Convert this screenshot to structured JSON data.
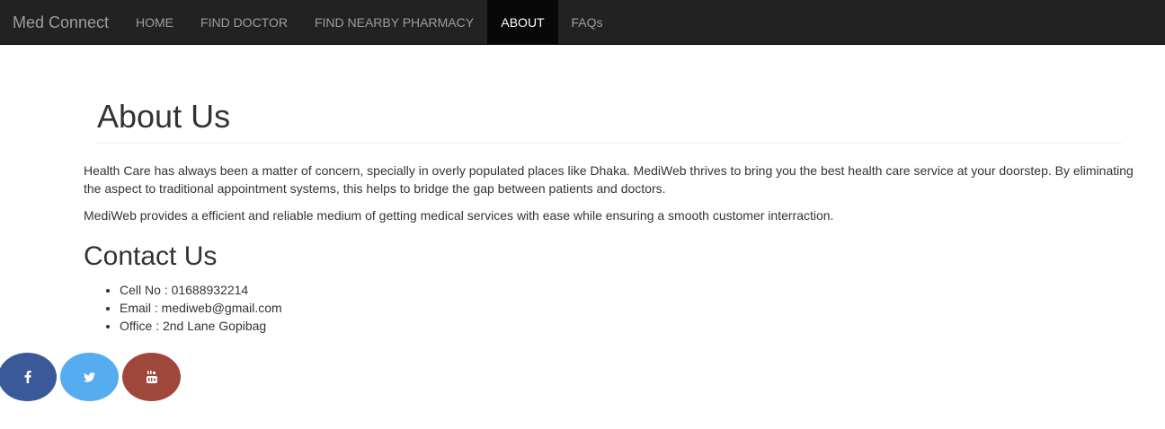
{
  "navbar": {
    "brand": "Med Connect",
    "items": [
      {
        "label": "HOME",
        "active": false
      },
      {
        "label": "FIND DOCTOR",
        "active": false
      },
      {
        "label": "FIND NEARBY PHARMACY",
        "active": false
      },
      {
        "label": "ABOUT",
        "active": true
      },
      {
        "label": "FAQs",
        "active": false
      }
    ],
    "background_color": "#222222",
    "active_background_color": "#080808"
  },
  "about": {
    "title": "About Us",
    "paragraphs": [
      "Health Care has always been a matter of concern, specially in overly populated places like Dhaka. MediWeb thrives to bring you the best health care service at your doorstep. By eliminating the aspect to traditional appointment systems, this helps to bridge the gap between patients and doctors.",
      "MediWeb provides a efficient and reliable medium of getting medical services with ease while ensuring a smooth customer interraction."
    ]
  },
  "contact": {
    "title": "Contact Us",
    "items": [
      "Cell No : 01688932214",
      "Email : mediweb@gmail.com",
      "Office : 2nd Lane Gopibag"
    ]
  },
  "social": [
    {
      "icon": "facebook-icon",
      "color": "#3b5998"
    },
    {
      "icon": "twitter-icon",
      "color": "#55acee"
    },
    {
      "icon": "youtube-icon",
      "color": "#a0473c"
    }
  ]
}
